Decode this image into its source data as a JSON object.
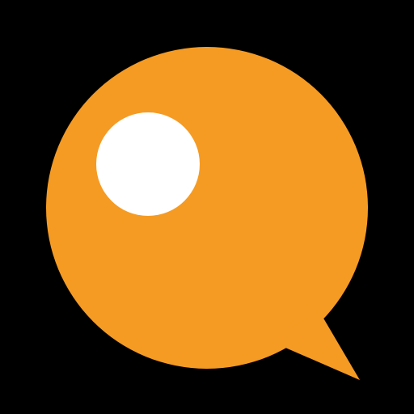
{
  "icon": {
    "name": "speech-bubble-icon",
    "background_color": "#000000",
    "bubble_color": "#F59B23",
    "highlight_color": "#FFFFFF"
  }
}
